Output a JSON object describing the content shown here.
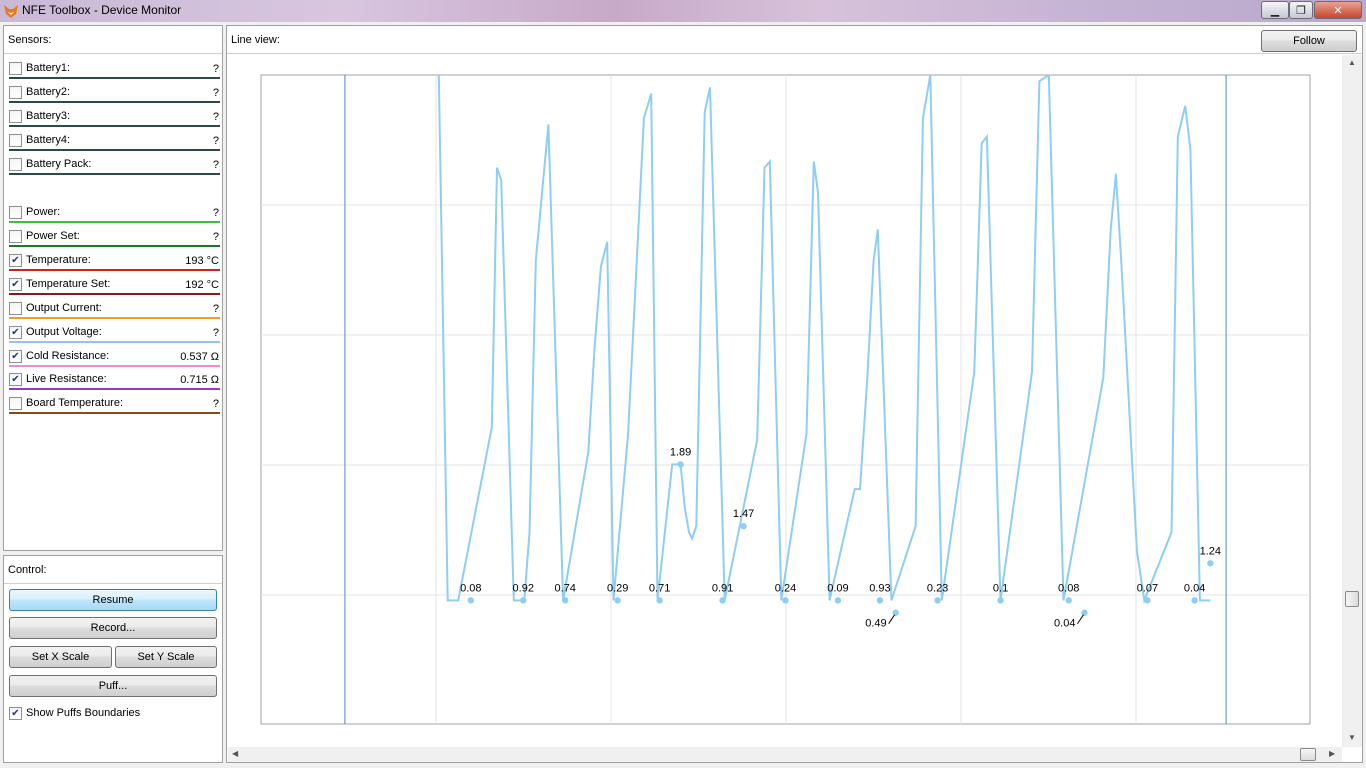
{
  "window": {
    "title": "NFE Toolbox - Device Monitor",
    "icon": "fox-icon"
  },
  "sensors": {
    "header": "Sensors:",
    "items": [
      {
        "label": "Battery1:",
        "value": "?",
        "checked": false,
        "color": "#2d4a4a"
      },
      {
        "label": "Battery2:",
        "value": "?",
        "checked": false,
        "color": "#2d4a4a"
      },
      {
        "label": "Battery3:",
        "value": "?",
        "checked": false,
        "color": "#2d4a4a"
      },
      {
        "label": "Battery4:",
        "value": "?",
        "checked": false,
        "color": "#2d4a4a"
      },
      {
        "label": "Battery Pack:",
        "value": "?",
        "checked": false,
        "color": "#2d4a4a"
      },
      {
        "label": "Power:",
        "value": "?",
        "checked": false,
        "color": "#3cbf3c"
      },
      {
        "label": "Power Set:",
        "value": "?",
        "checked": false,
        "color": "#157a2a"
      },
      {
        "label": "Temperature:",
        "value": "193 °C",
        "checked": true,
        "color": "#d42020"
      },
      {
        "label": "Temperature Set:",
        "value": "192 °C",
        "checked": true,
        "color": "#8a1818"
      },
      {
        "label": "Output Current:",
        "value": "?",
        "checked": false,
        "color": "#f0a020"
      },
      {
        "label": "Output Voltage:",
        "value": "?",
        "checked": true,
        "color": "#8cc8e8"
      },
      {
        "label": "Cold Resistance:",
        "value": "0.537 Ω",
        "checked": true,
        "color": "#f08cc8"
      },
      {
        "label": "Live Resistance:",
        "value": "0.715 Ω",
        "checked": true,
        "color": "#9a38c8"
      },
      {
        "label": "Board Temperature:",
        "value": "?",
        "checked": false,
        "color": "#8a4a1a"
      }
    ]
  },
  "control": {
    "header": "Control:",
    "resume": "Resume",
    "record": "Record...",
    "set_x_scale": "Set X Scale",
    "set_y_scale": "Set Y Scale",
    "puff": "Puff...",
    "show_puffs_label": "Show Puffs Boundaries",
    "show_puffs_checked": true
  },
  "line_view": {
    "header": "Line view:",
    "follow": "Follow"
  },
  "chart_data": {
    "type": "line",
    "series_color": "#8fcdf2",
    "grid": true,
    "puff_boundaries": [
      0.08,
      0.92
    ],
    "annotations": [
      {
        "text": "0.08",
        "x": 0.2,
        "y": 0.0
      },
      {
        "text": "0.92",
        "x": 0.25,
        "y": 0.0
      },
      {
        "text": "0.74",
        "x": 0.29,
        "y": 0.0
      },
      {
        "text": "0.29",
        "x": 0.34,
        "y": 0.0
      },
      {
        "text": "0.71",
        "x": 0.38,
        "y": 0.0
      },
      {
        "text": "1.89",
        "x": 0.4,
        "y": 0.22
      },
      {
        "text": "0.91",
        "x": 0.44,
        "y": 0.0
      },
      {
        "text": "1.47",
        "x": 0.46,
        "y": 0.12
      },
      {
        "text": "0.24",
        "x": 0.5,
        "y": 0.0
      },
      {
        "text": "0.09",
        "x": 0.55,
        "y": 0.0
      },
      {
        "text": "0.93",
        "x": 0.59,
        "y": 0.0
      },
      {
        "text": "0.49",
        "x": 0.605,
        "y": -0.02
      },
      {
        "text": "0.23",
        "x": 0.645,
        "y": 0.0
      },
      {
        "text": "0.1",
        "x": 0.705,
        "y": 0.0
      },
      {
        "text": "0.08",
        "x": 0.77,
        "y": 0.0
      },
      {
        "text": "0.04",
        "x": 0.785,
        "y": -0.02
      },
      {
        "text": "0.07",
        "x": 0.845,
        "y": 0.0
      },
      {
        "text": "0.04",
        "x": 0.89,
        "y": 0.0
      },
      {
        "text": "1.24",
        "x": 0.905,
        "y": 0.06
      }
    ],
    "series": [
      {
        "points": [
          [
            0.165,
            1.3
          ],
          [
            0.178,
            0.0
          ],
          [
            0.188,
            0.0
          ],
          [
            0.22,
            0.28
          ],
          [
            0.225,
            0.7
          ],
          [
            0.229,
            0.68
          ],
          [
            0.241,
            0.0
          ],
          [
            0.251,
            0.0
          ],
          [
            0.256,
            0.11
          ],
          [
            0.262,
            0.55
          ],
          [
            0.274,
            0.77
          ],
          [
            0.288,
            0.0
          ],
          [
            0.312,
            0.24
          ],
          [
            0.318,
            0.41
          ],
          [
            0.324,
            0.54
          ],
          [
            0.33,
            0.58
          ],
          [
            0.336,
            0.0
          ],
          [
            0.35,
            0.27
          ],
          [
            0.365,
            0.78
          ],
          [
            0.372,
            0.82
          ],
          [
            0.378,
            0.0
          ],
          [
            0.392,
            0.22
          ],
          [
            0.4,
            0.22
          ],
          [
            0.404,
            0.15
          ],
          [
            0.408,
            0.11
          ],
          [
            0.411,
            0.1
          ],
          [
            0.415,
            0.12
          ],
          [
            0.423,
            0.79
          ],
          [
            0.428,
            0.83
          ],
          [
            0.442,
            0.0
          ],
          [
            0.473,
            0.26
          ],
          [
            0.48,
            0.7
          ],
          [
            0.485,
            0.71
          ],
          [
            0.496,
            0.0
          ],
          [
            0.52,
            0.27
          ],
          [
            0.527,
            0.71
          ],
          [
            0.531,
            0.66
          ],
          [
            0.542,
            0.0
          ],
          [
            0.566,
            0.18
          ],
          [
            0.571,
            0.18
          ],
          [
            0.578,
            0.36
          ],
          [
            0.584,
            0.55
          ],
          [
            0.588,
            0.6
          ],
          [
            0.601,
            0.0
          ],
          [
            0.624,
            0.12
          ],
          [
            0.631,
            0.78
          ],
          [
            0.638,
            0.85
          ],
          [
            0.649,
            0.0
          ],
          [
            0.68,
            0.37
          ],
          [
            0.687,
            0.74
          ],
          [
            0.692,
            0.75
          ],
          [
            0.705,
            0.0
          ],
          [
            0.735,
            0.37
          ],
          [
            0.742,
            0.84
          ],
          [
            0.751,
            0.85
          ],
          [
            0.765,
            0.0
          ],
          [
            0.803,
            0.36
          ],
          [
            0.81,
            0.6
          ],
          [
            0.815,
            0.69
          ],
          [
            0.82,
            0.55
          ],
          [
            0.835,
            0.08
          ],
          [
            0.842,
            0.0
          ],
          [
            0.868,
            0.11
          ],
          [
            0.874,
            0.75
          ],
          [
            0.881,
            0.8
          ],
          [
            0.886,
            0.73
          ],
          [
            0.895,
            0.0
          ],
          [
            0.905,
            0.0
          ]
        ]
      }
    ],
    "ylim": [
      -0.2,
      0.85
    ],
    "xlim": [
      0.0,
      1.0
    ]
  }
}
